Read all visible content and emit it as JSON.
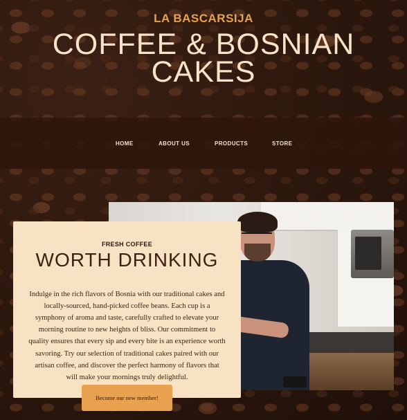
{
  "brand": {
    "name": "LA BASCARSIJA"
  },
  "hero": {
    "headline_line1": "COFFEE & BOSNIAN",
    "headline_line2": "CAKES"
  },
  "nav": {
    "items": [
      {
        "label": "HOME"
      },
      {
        "label": "ABOUT US"
      },
      {
        "label": "PRODUCTS"
      },
      {
        "label": "STORE"
      }
    ]
  },
  "feature": {
    "kicker": "FRESH COFFEE",
    "title": "WORTH DRINKING",
    "body": "Indulge in the rich flavors of Bosnia with our traditional cakes and locally-sourced, hand-picked coffee beans. Each cup is a symphony of aroma and taste, carefully crafted to elevate your morning routine to new heights of bliss. Our commitment to quality ensures that every sip and every bite is an experience worth savoring. Try our selection of traditional cakes paired with our artisan coffee, and discover the perfect harmony of flavors that will make your mornings truly delightful.",
    "cta_label": "Become our new member!"
  },
  "colors": {
    "accent": "#e8a24f",
    "card": "#f8e2c4",
    "text_dark": "#2b160b",
    "headline": "#f7e3c5"
  }
}
